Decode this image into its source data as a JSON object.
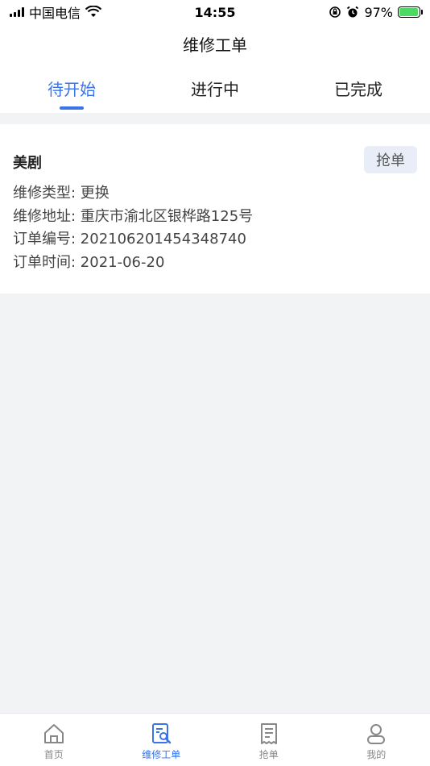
{
  "status_bar": {
    "carrier": "中国电信",
    "time": "14:55",
    "battery": "97%",
    "battery_level": 0.97
  },
  "header": {
    "title": "维修工单"
  },
  "tabs": [
    {
      "label": "待开始",
      "active": true
    },
    {
      "label": "进行中",
      "active": false
    },
    {
      "label": "已完成",
      "active": false
    }
  ],
  "order": {
    "title": "美剧",
    "action_label": "抢单",
    "rows": [
      "维修类型: 更换",
      "维修地址: 重庆市渝北区银桦路125号",
      "订单编号: 202106201454348740",
      "订单时间: 2021-06-20"
    ]
  },
  "bottom_nav": [
    {
      "label": "首页",
      "icon": "home-icon",
      "active": false
    },
    {
      "label": "维修工单",
      "icon": "repair-order-icon",
      "active": true
    },
    {
      "label": "抢单",
      "icon": "receipt-icon",
      "active": false
    },
    {
      "label": "我的",
      "icon": "profile-icon",
      "active": false
    }
  ],
  "colors": {
    "accent": "#3a74e8",
    "background": "#f2f3f5",
    "grab_button_bg": "#e8edf7"
  }
}
